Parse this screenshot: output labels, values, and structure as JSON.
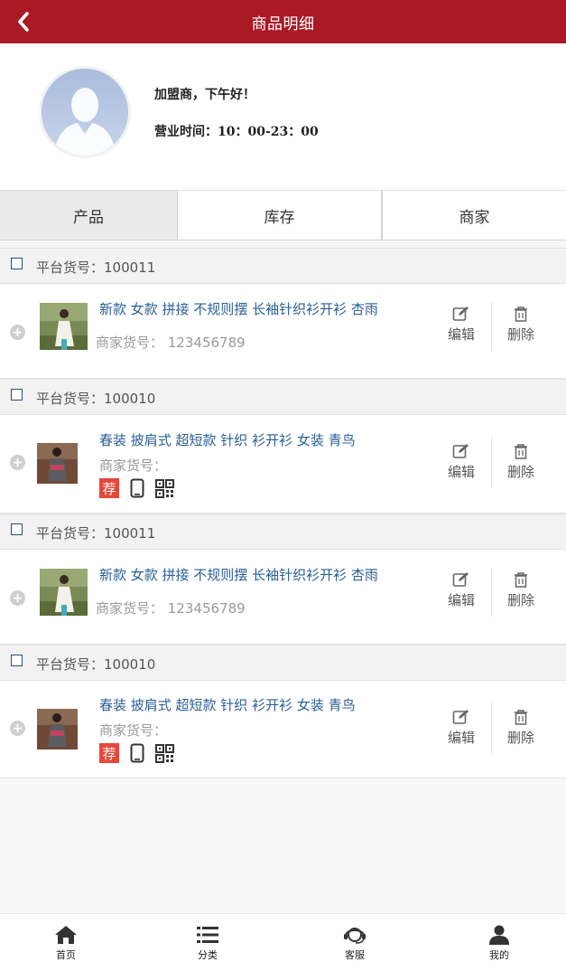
{
  "header": {
    "title": "商品明细",
    "back_icon": "chevron-left-icon"
  },
  "profile": {
    "greeting": "加盟商，下午好！",
    "hours": "营业时间：10：00-23：00"
  },
  "tabs": [
    {
      "label": "产品",
      "active": true
    },
    {
      "label": "库存",
      "active": false
    },
    {
      "label": "商家",
      "active": false
    }
  ],
  "products": [
    {
      "platform_id": "平台货号：100011",
      "name": "新款 女款 拼接 不规则摆 长袖针织衫开衫 杏雨",
      "merchant_code": "商家货号： 123456789",
      "show_badges": false
    },
    {
      "platform_id": "平台货号：100010",
      "name": "春装 披肩式 超短款 针织 衫开衫 女装 青鸟",
      "merchant_code": "商家货号：",
      "show_badges": true,
      "badge_label": "荐"
    },
    {
      "platform_id": "平台货号：100011",
      "name": "新款 女款 拼接 不规则摆 长袖针织衫开衫 杏雨",
      "merchant_code": "商家货号： 123456789",
      "show_badges": false
    },
    {
      "platform_id": "平台货号：100010",
      "name": "春装 披肩式 超短款 针织 衫开衫 女装 青鸟",
      "merchant_code": "商家货号：",
      "show_badges": true,
      "badge_label": "荐"
    }
  ],
  "actions": {
    "edit": "编辑",
    "delete": "删除"
  },
  "bottom_nav": [
    {
      "label": "首页",
      "icon": "home-icon"
    },
    {
      "label": "分类",
      "icon": "list-icon"
    },
    {
      "label": "客服",
      "icon": "headset-icon"
    },
    {
      "label": "我的",
      "icon": "user-icon"
    }
  ],
  "colors": {
    "brand": "#a91a24",
    "link": "#2b5f96",
    "badge": "#e5483b"
  }
}
